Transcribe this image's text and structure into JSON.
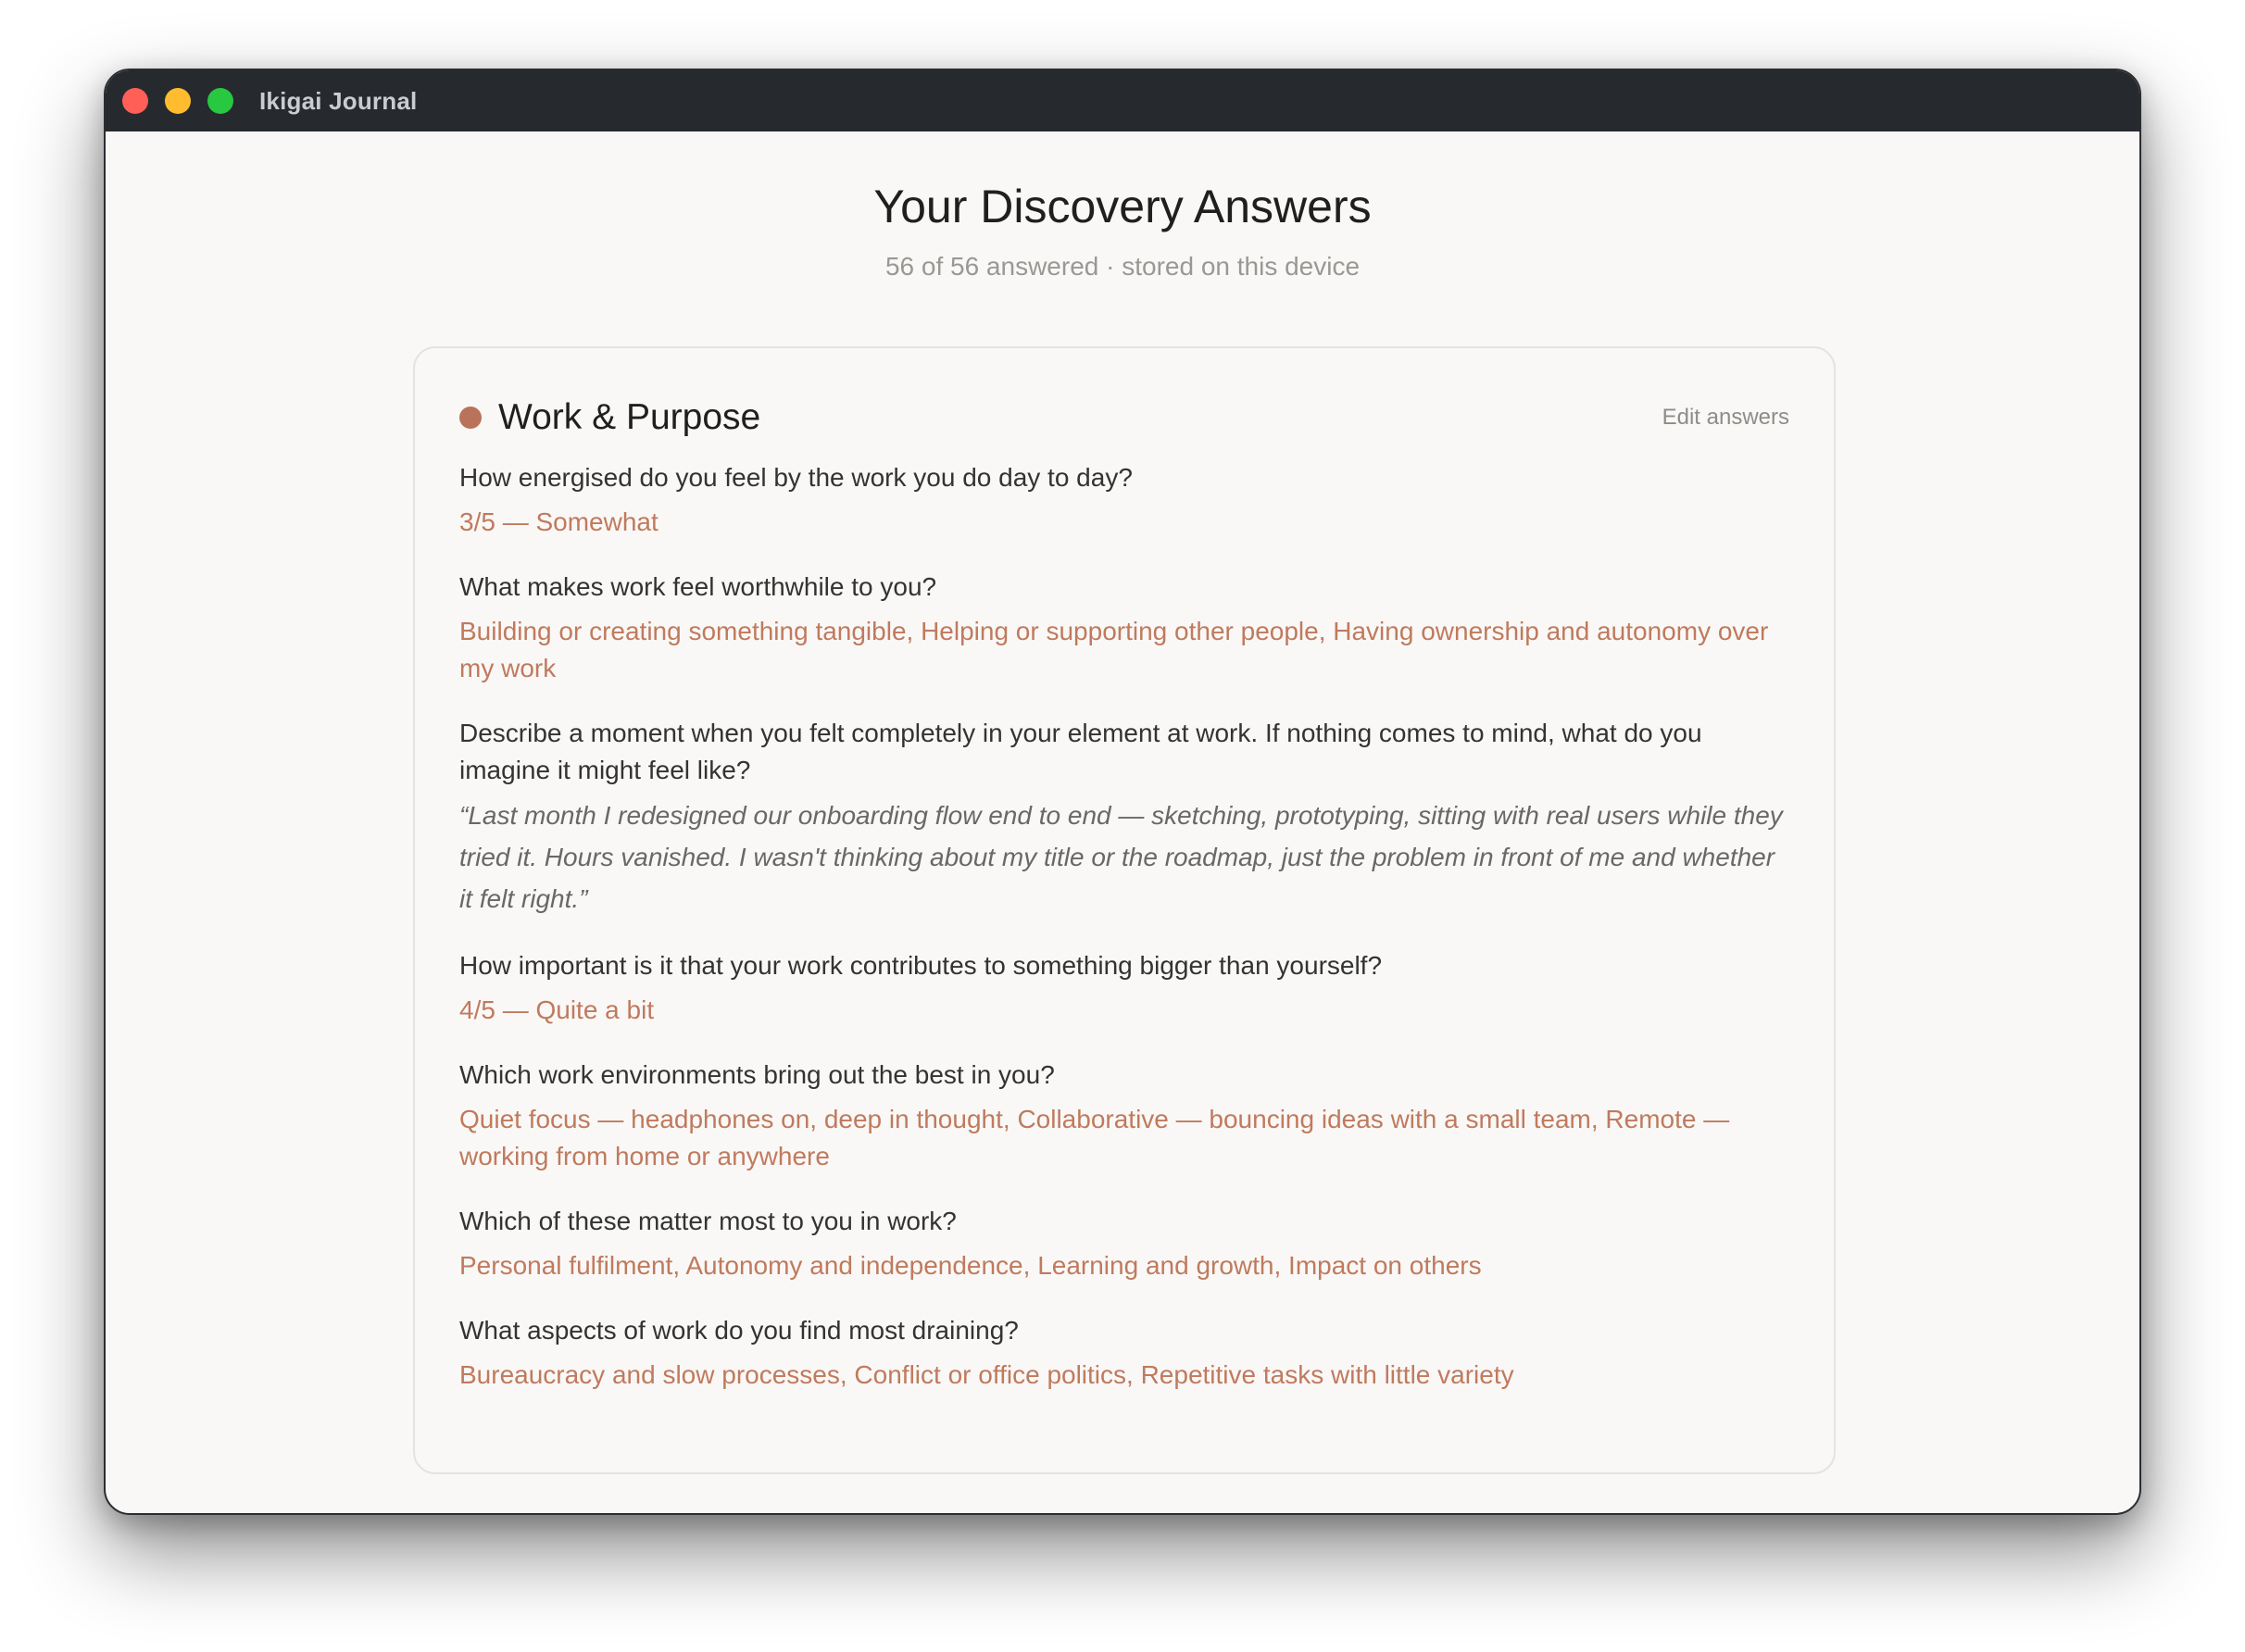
{
  "window": {
    "title": "Ikigai Journal"
  },
  "page": {
    "title": "Your Discovery Answers",
    "subtitle": "56 of 56 answered · stored on this device"
  },
  "section": {
    "title": "Work & Purpose",
    "edit_label": "Edit answers",
    "accent_color": "#b8735a",
    "items": [
      {
        "question": "How energised do you feel by the work you do day to day?",
        "answer": "3/5 — Somewhat"
      },
      {
        "question": "What makes work feel worthwhile to you?",
        "answer": "Building or creating something tangible, Helping or supporting other people, Having ownership and autonomy over my work"
      },
      {
        "question": "Describe a moment when you felt completely in your element at work. If nothing comes to mind, what do you imagine it might feel like?",
        "answer": "“Last month I redesigned our onboarding flow end to end — sketching, prototyping, sitting with real users while they tried it. Hours vanished. I wasn't thinking about my title or the roadmap, just the problem in front of me and whether it felt right.”"
      },
      {
        "question": "How important is it that your work contributes to something bigger than yourself?",
        "answer": "4/5 — Quite a bit"
      },
      {
        "question": "Which work environments bring out the best in you?",
        "answer": "Quiet focus — headphones on, deep in thought, Collaborative — bouncing ideas with a small team, Remote — working from home or anywhere"
      },
      {
        "question": "Which of these matter most to you in work?",
        "answer": "Personal fulfilment, Autonomy and independence, Learning and growth, Impact on others"
      },
      {
        "question": "What aspects of work do you find most draining?",
        "answer": "Bureaucracy and slow processes, Conflict or office politics, Repetitive tasks with little variety"
      }
    ]
  }
}
